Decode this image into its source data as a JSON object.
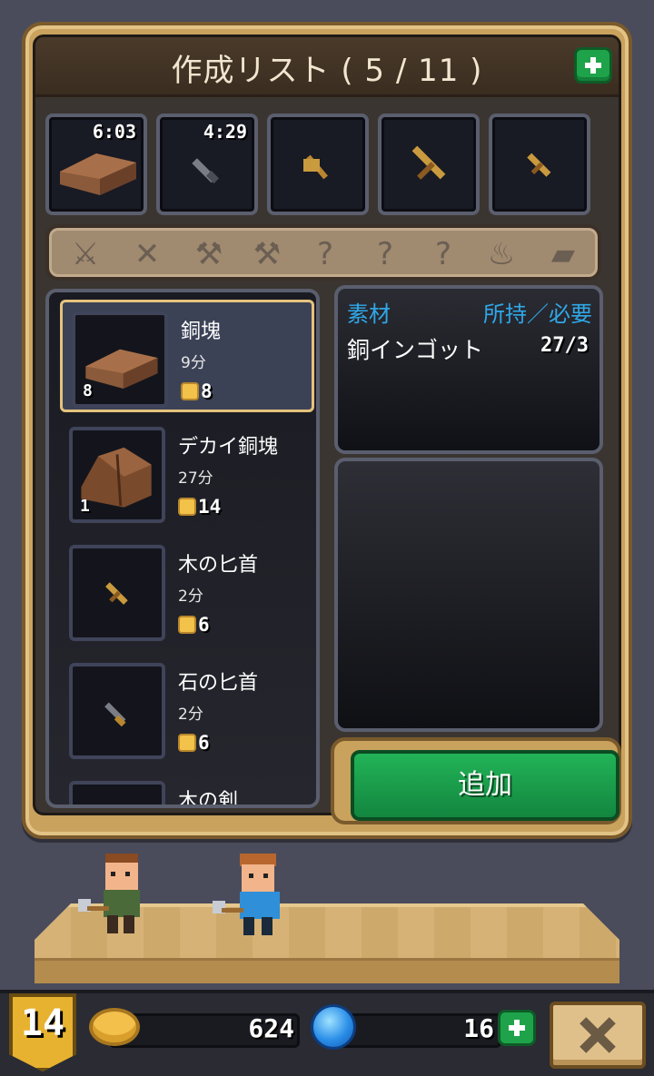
{
  "title": "作成リスト ( 5 / 11 )",
  "queue": [
    {
      "time": "6:03",
      "icon": "copper-ingot-icon"
    },
    {
      "time": "4:29",
      "icon": "stone-dagger-icon"
    },
    {
      "time": "",
      "icon": "wooden-axe-icon"
    },
    {
      "time": "",
      "icon": "wooden-sword-icon"
    },
    {
      "time": "",
      "icon": "wooden-dagger-icon"
    }
  ],
  "categories": [
    {
      "icon": "dagger-category-icon",
      "glyph": "⚔"
    },
    {
      "icon": "sword-category-icon",
      "glyph": "✕"
    },
    {
      "icon": "axe-category-icon",
      "glyph": "⚒"
    },
    {
      "icon": "hammer-category-icon",
      "glyph": "⚒"
    },
    {
      "icon": "locked-category-icon",
      "glyph": "?"
    },
    {
      "icon": "locked-category-icon",
      "glyph": "?"
    },
    {
      "icon": "locked-category-icon",
      "glyph": "?"
    },
    {
      "icon": "pot-category-icon",
      "glyph": "♨"
    },
    {
      "icon": "ingot-category-icon",
      "glyph": "▰"
    }
  ],
  "recipes": [
    {
      "name": "銅塊",
      "time": "9分",
      "cost": "8",
      "count": "8",
      "icon": "copper-ingot-icon"
    },
    {
      "name": "デカイ銅塊",
      "time": "27分",
      "cost": "14",
      "count": "1",
      "icon": "big-copper-ingot-icon"
    },
    {
      "name": "木の匕首",
      "time": "2分",
      "cost": "6",
      "count": "",
      "icon": "wooden-dagger-icon"
    },
    {
      "name": "石の匕首",
      "time": "2分",
      "cost": "6",
      "count": "",
      "icon": "stone-dagger-icon"
    },
    {
      "name": "木の剣",
      "time": "",
      "cost": "",
      "count": "",
      "icon": "wooden-sword-icon"
    }
  ],
  "materials": {
    "header_left": "素材",
    "header_right": "所持／必要",
    "item_name": "銅インゴット",
    "item_qty": "27/3"
  },
  "add_button": "追加",
  "hud": {
    "level": "14",
    "gold": "624",
    "gems": "16"
  },
  "colors": {
    "frame_gold": "#c9a25e",
    "accent_blue": "#2fa8e8",
    "button_green": "#1fa34a"
  }
}
